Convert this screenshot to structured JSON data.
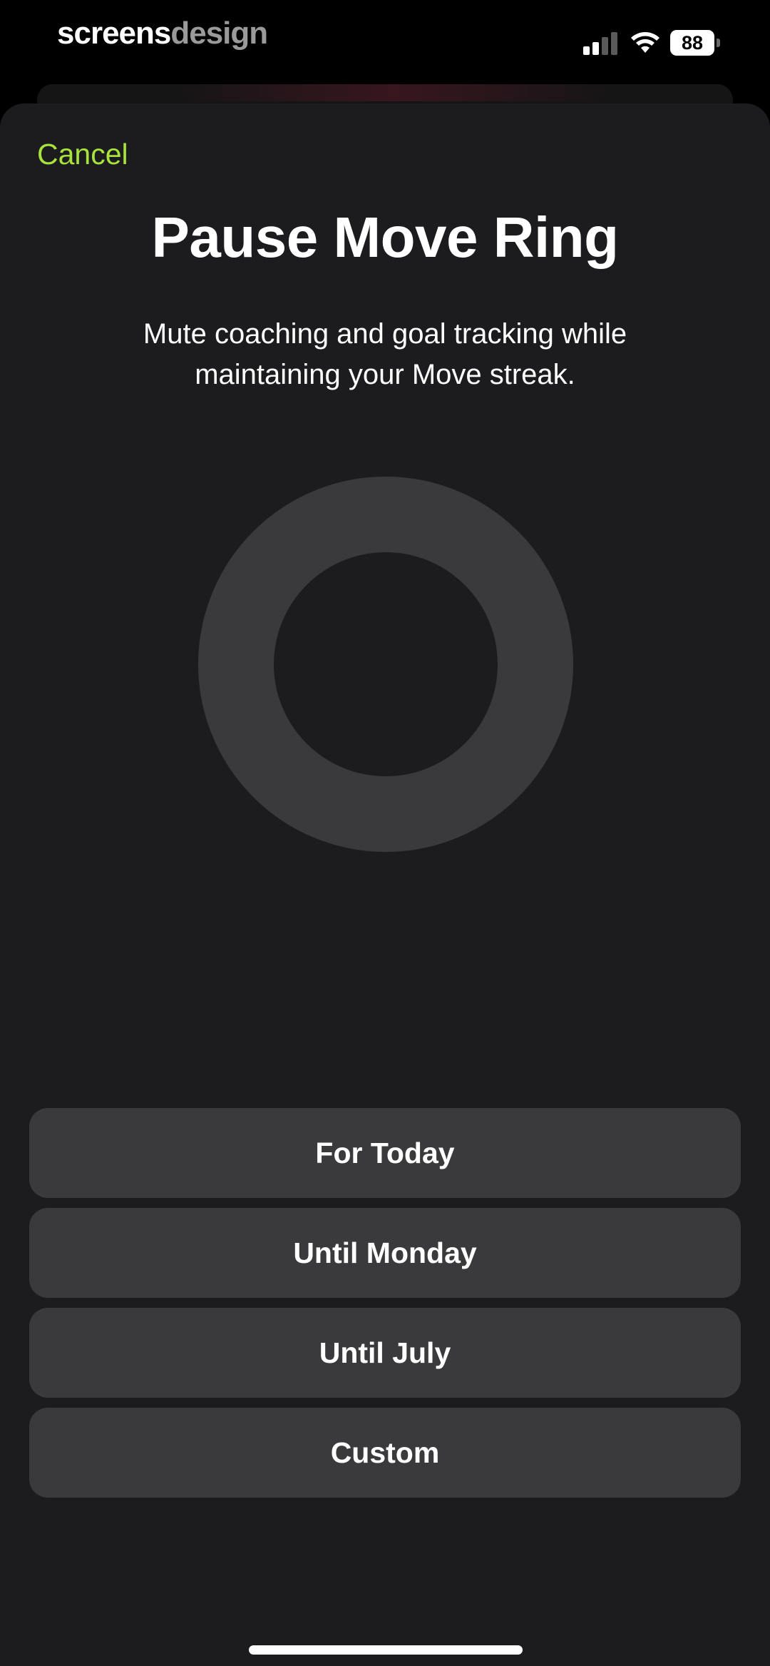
{
  "status_bar": {
    "brand_part1": "screens",
    "brand_part2": "design",
    "battery_level": "88",
    "signal_bars_filled": 2,
    "signal_bars_total": 4
  },
  "sheet": {
    "cancel_label": "Cancel",
    "title": "Pause Move Ring",
    "subtitle": "Mute coaching and goal tracking while maintaining your Move streak.",
    "ring_color": "#3a3a3c"
  },
  "options": [
    {
      "label": "For Today"
    },
    {
      "label": "Until Monday"
    },
    {
      "label": "Until July"
    },
    {
      "label": "Custom"
    }
  ],
  "colors": {
    "accent": "#a8e33c",
    "background": "#1c1c1e",
    "button": "#3a3a3c"
  },
  "icons": [
    "cellular-signal-icon",
    "wifi-icon",
    "battery-icon"
  ]
}
